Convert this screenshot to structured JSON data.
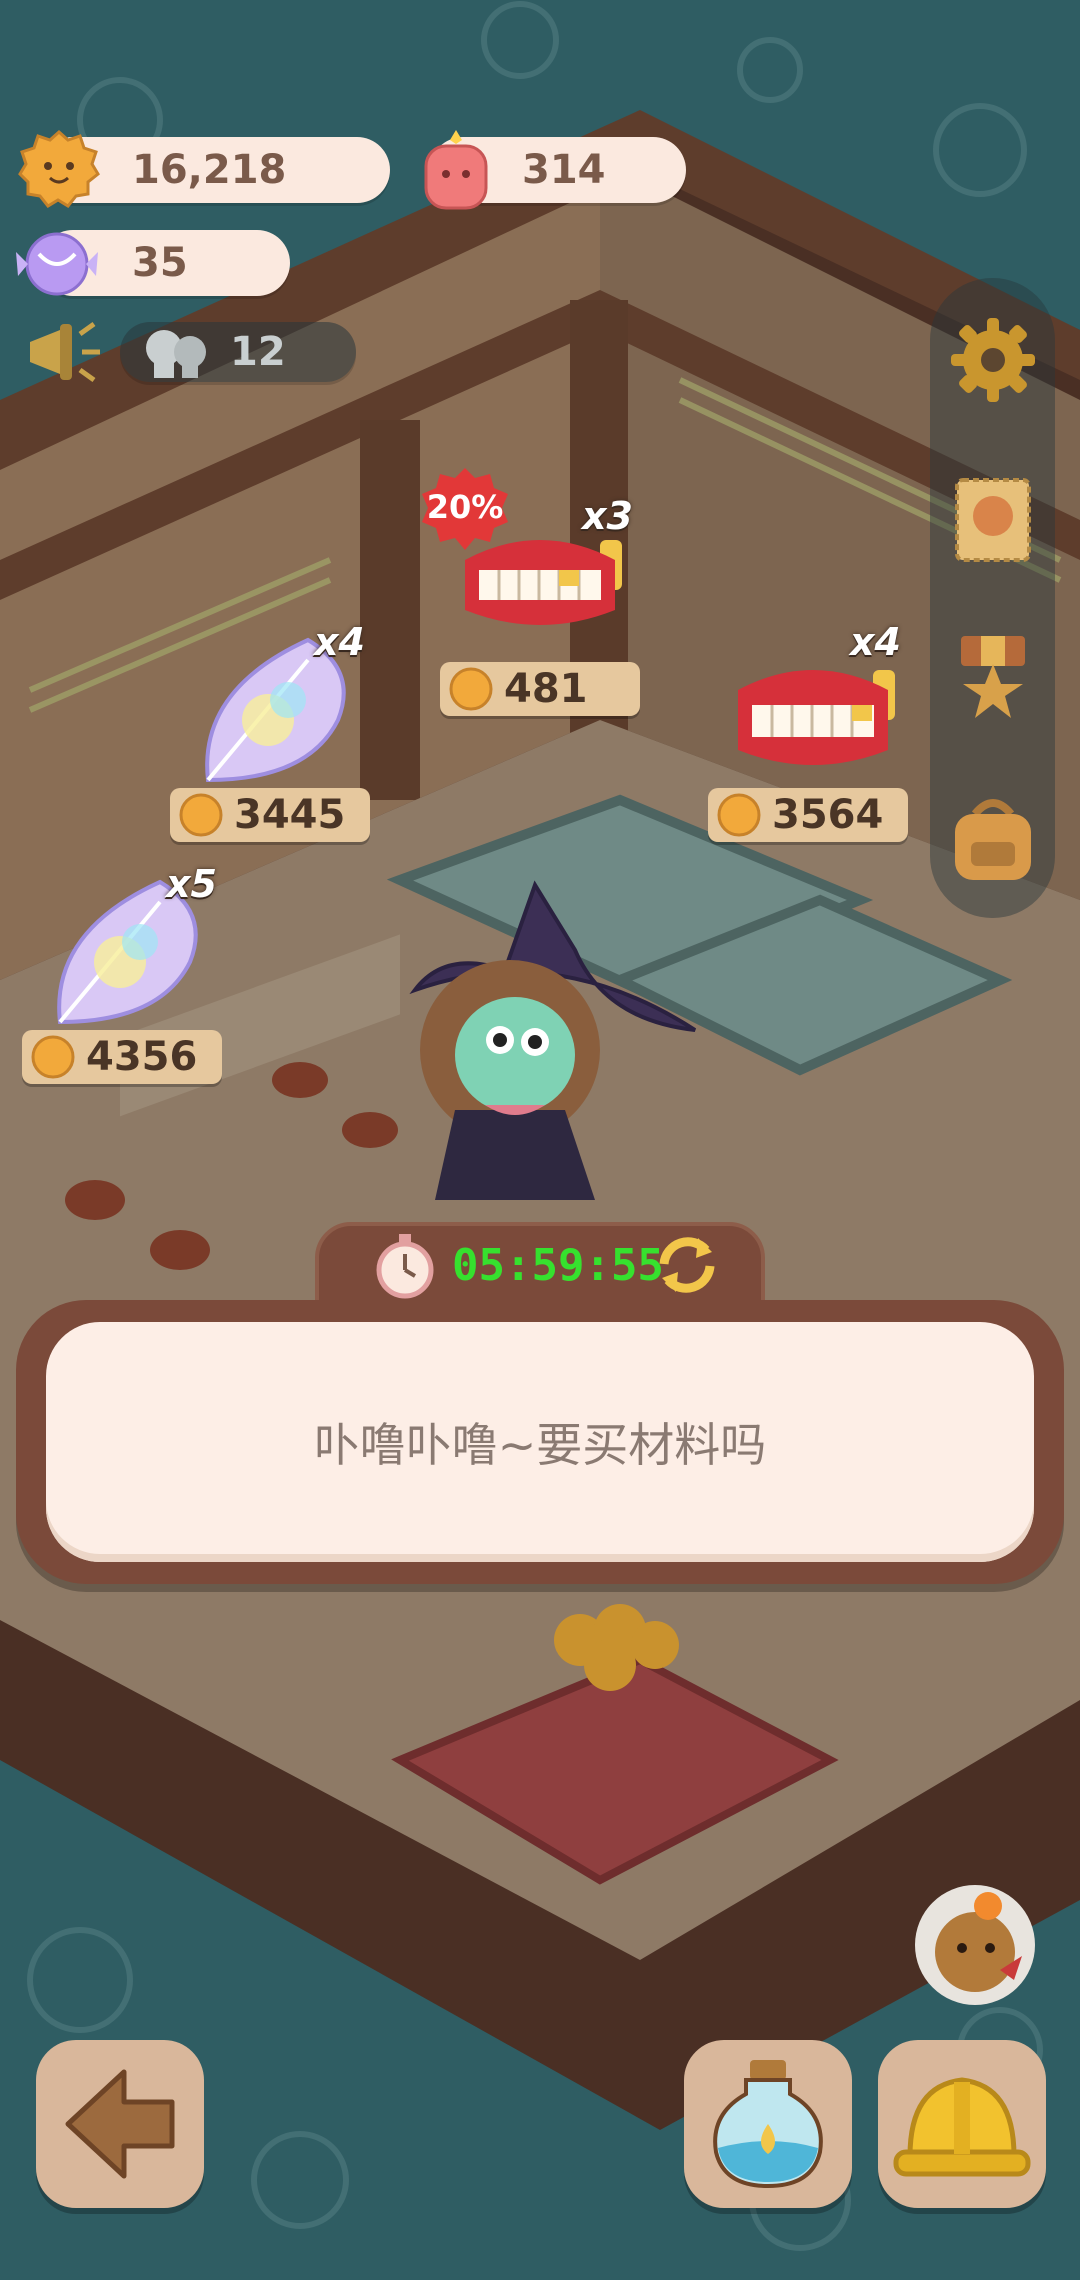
{
  "resources": {
    "cookies": "16,218",
    "gems": "314",
    "candy": "35",
    "helpers": "12"
  },
  "shop": {
    "items": [
      {
        "name": "teeth",
        "multiplier": "x3",
        "price": "481",
        "discount": "20%"
      },
      {
        "name": "feather",
        "multiplier": "x4",
        "price": "3445"
      },
      {
        "name": "teeth",
        "multiplier": "x4",
        "price": "3564"
      },
      {
        "name": "feather",
        "multiplier": "x5",
        "price": "4356"
      }
    ],
    "timer": "05:59:55"
  },
  "dialog": {
    "text": "卟噜卟噜~要买材料吗"
  },
  "icons": {
    "settings": "gear-icon",
    "stamp": "stamp-icon",
    "medal": "medal-icon",
    "bag": "backpack-icon",
    "back": "back-arrow-icon",
    "potion": "potion-icon",
    "helmet": "hard-hat-icon",
    "refresh": "refresh-icon",
    "stopwatch": "stopwatch-icon"
  },
  "colors": {
    "timer_green": "#36e12e",
    "panel_brown": "#7b4a3a",
    "cream": "#fdeee6"
  }
}
